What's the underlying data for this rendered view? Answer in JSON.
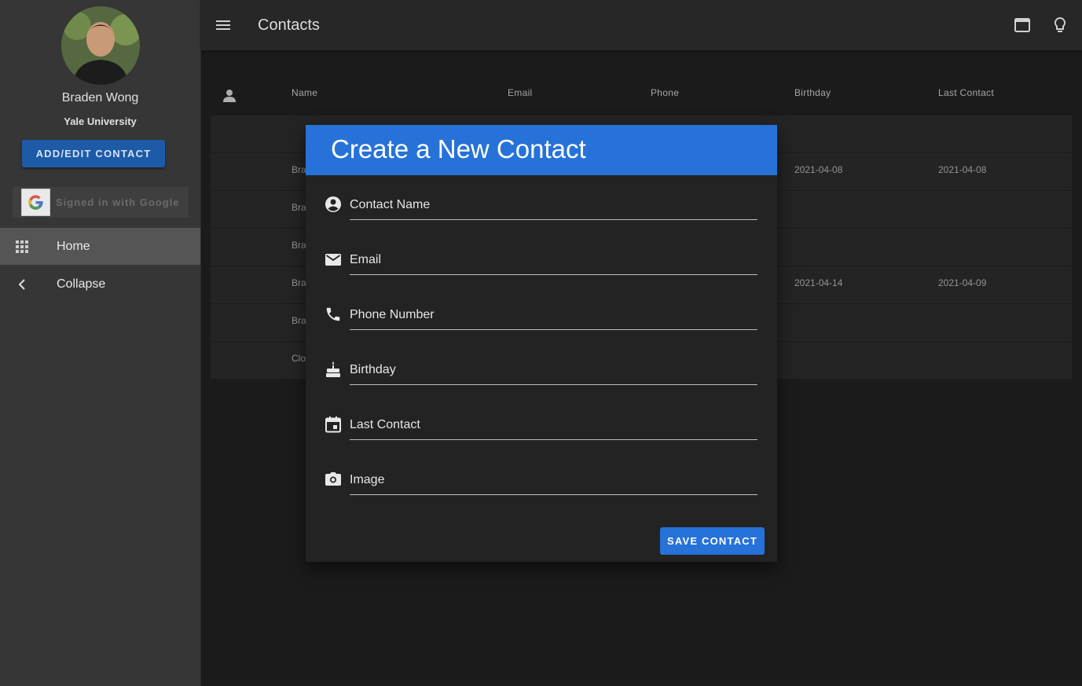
{
  "sidebar": {
    "user": {
      "name": "Braden Wong",
      "organization": "Yale University"
    },
    "add_edit_button": "ADD/EDIT CONTACT",
    "google_signin": "Signed in with Google",
    "nav": [
      {
        "label": "Home",
        "icon": "apps-grid-icon"
      },
      {
        "label": "Collapse",
        "icon": "chevron-left-icon"
      }
    ]
  },
  "topbar": {
    "title": "Contacts",
    "icons": [
      "menu-icon",
      "window-icon",
      "lightbulb-icon"
    ]
  },
  "table": {
    "columns": [
      "Name",
      "Email",
      "Phone",
      "Birthday",
      "Last Contact"
    ],
    "rows": [
      {
        "name": "",
        "birthday": "",
        "last_contact": ""
      },
      {
        "name": "Bra",
        "birthday": "2021-04-08",
        "last_contact": "2021-04-08"
      },
      {
        "name": "Bra",
        "birthday": "",
        "last_contact": ""
      },
      {
        "name": "Bra",
        "birthday": "",
        "last_contact": ""
      },
      {
        "name": "Bra",
        "birthday": "2021-04-14",
        "last_contact": "2021-04-09"
      },
      {
        "name": "Bra",
        "birthday": "",
        "last_contact": ""
      },
      {
        "name": "Clo",
        "birthday": "",
        "last_contact": ""
      }
    ]
  },
  "dialog": {
    "title": "Create a New Contact",
    "fields": [
      {
        "placeholder": "Contact Name",
        "icon": "account-circle-icon"
      },
      {
        "placeholder": "Email",
        "icon": "email-icon"
      },
      {
        "placeholder": "Phone Number",
        "icon": "phone-icon"
      },
      {
        "placeholder": "Birthday",
        "icon": "cake-icon"
      },
      {
        "placeholder": "Last Contact",
        "icon": "calendar-icon"
      },
      {
        "placeholder": "Image",
        "icon": "camera-icon"
      }
    ],
    "save_button": "SAVE CONTACT"
  },
  "colors": {
    "primary": "#2672d8",
    "sidebar": "#363636",
    "background": "#1f1f1f"
  }
}
